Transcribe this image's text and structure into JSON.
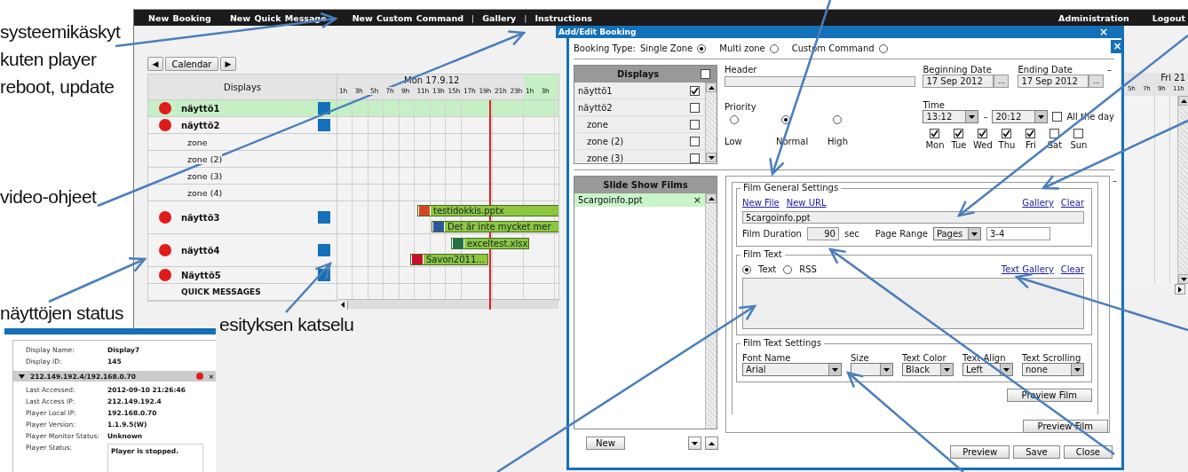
{
  "annotations": [
    {
      "lines": [
        "systeemikäskyt",
        "kuten player",
        "reboot, update"
      ]
    },
    {
      "lines": [
        "video-ohjeet"
      ]
    },
    {
      "lines": [
        "näyttöjen status"
      ]
    },
    {
      "lines": [
        "esityksen katselu"
      ]
    }
  ],
  "nav": {
    "left": [
      {
        "label": "New Booking",
        "kind": "link"
      },
      {
        "label": "New Quick Message",
        "kind": "link"
      },
      {
        "label": "New Custom Command",
        "kind": "link"
      },
      {
        "label": "|",
        "kind": "separator"
      },
      {
        "label": "Gallery",
        "kind": "link"
      },
      {
        "label": "|",
        "kind": "separator"
      },
      {
        "label": "Instructions",
        "kind": "link"
      }
    ],
    "right": [
      "Administration",
      "Logout"
    ]
  },
  "calendar": {
    "prev": "◀",
    "button": "Calendar",
    "next": "▶",
    "displays_header": "Displays",
    "day": "Mon 17.9.12",
    "hours": [
      "1h",
      "3h",
      "5h",
      "7h",
      "9h",
      "11h",
      "13h",
      "15h",
      "17h",
      "19h",
      "21h",
      "23h",
      "1h",
      "3h"
    ],
    "rows": [
      {
        "kind": "display",
        "name": "näyttö1",
        "color": "#e01b1b",
        "selected": true,
        "bookings": []
      },
      {
        "kind": "display",
        "name": "näyttö2",
        "color": "#e01b1b",
        "selected": false,
        "bookings": []
      },
      {
        "kind": "zone",
        "name": "zone"
      },
      {
        "kind": "zone",
        "name": "zone (2)"
      },
      {
        "kind": "zone",
        "name": "zone (3)"
      },
      {
        "kind": "zone",
        "name": "zone (4)"
      },
      {
        "kind": "display",
        "name": "näyttö3",
        "color": "#e01b1b",
        "selected": false,
        "bookings": [
          {
            "label": "testidokkis.pptx",
            "kind": "pptx"
          },
          {
            "label": "Det är inte mycket mer",
            "kind": "doc"
          }
        ]
      },
      {
        "kind": "display",
        "name": "näyttö4",
        "color": "#e01b1b",
        "selected": false,
        "bookings": [
          {
            "label": "exceltest.xlsx",
            "kind": "xlsx"
          },
          {
            "label": "Savon2011...",
            "kind": "pdf"
          }
        ]
      },
      {
        "kind": "display",
        "name": "Näyttö5",
        "color": "#e01b1b",
        "selected": false,
        "bookings": []
      },
      {
        "kind": "quick",
        "name": "QUICK MESSAGES"
      }
    ],
    "side_day": "Fri 21",
    "side_hours": [
      "5h",
      "7h",
      "9h",
      "11h"
    ]
  },
  "stats": {
    "fields": [
      {
        "label": "Display Name:",
        "value": "Display7"
      },
      {
        "label": "Display ID:",
        "value": "145"
      }
    ],
    "connection": {
      "address": "212.149.192.4/192.168.0.70",
      "expanded": true,
      "color": "#e01b1b",
      "close": "×"
    },
    "details": [
      {
        "label": "Last Accessed:",
        "value": "2012-09-10 21:26:46"
      },
      {
        "label": "Last Access IP:",
        "value": "212.149.192.4"
      },
      {
        "label": "Player Local IP:",
        "value": "192.168.0.70"
      },
      {
        "label": "Player Version:",
        "value": "1.1.9.5(W)"
      },
      {
        "label": "Player Monitor Status:",
        "value": "Unknown"
      }
    ],
    "status_label": "Player Status:",
    "status_value": "Player is stopped."
  },
  "dialog": {
    "title": "Add/Edit Booking",
    "close": "×",
    "close2": "×",
    "booking_type_label": "Booking Type:",
    "booking_types": [
      {
        "label": "Single Zone",
        "selected": true
      },
      {
        "label": "Multi zone",
        "selected": false
      },
      {
        "label": "Custom Command",
        "selected": false
      }
    ],
    "toggle": "–",
    "toggle2": "–",
    "displays": {
      "title": "Displays",
      "all_checked": false,
      "items": [
        {
          "name": "näyttö1",
          "checked": true,
          "zone": false
        },
        {
          "name": "näyttö2",
          "checked": false,
          "zone": false
        },
        {
          "name": "zone",
          "checked": false,
          "zone": true
        },
        {
          "name": "zone (2)",
          "checked": false,
          "zone": true
        },
        {
          "name": "zone (3)",
          "checked": false,
          "zone": true
        }
      ]
    },
    "header_label": "Header",
    "priority_label": "Priority",
    "priorities": [
      {
        "label": "Low",
        "selected": false
      },
      {
        "label": "Normal",
        "selected": true
      },
      {
        "label": "High",
        "selected": false
      }
    ],
    "begin_label": "Beginning Date",
    "begin": "17 Sep 2012",
    "end_label": "Ending Date",
    "end": "17 Sep 2012",
    "picker": "...",
    "time_label": "Time",
    "time_from": "13:12",
    "dash": "–",
    "time_to": "20:12",
    "all_day": {
      "label": "All the day",
      "checked": false
    },
    "days": [
      {
        "label": "Mon",
        "checked": true
      },
      {
        "label": "Tue",
        "checked": true
      },
      {
        "label": "Wed",
        "checked": true
      },
      {
        "label": "Thu",
        "checked": true
      },
      {
        "label": "Fri",
        "checked": true
      },
      {
        "label": "Sat",
        "checked": false
      },
      {
        "label": "Sun",
        "checked": false
      }
    ],
    "films": {
      "title": "Slide Show Films",
      "items": [
        {
          "name": "5cargoinfo.ppt",
          "selected": true,
          "remove": "×"
        }
      ]
    },
    "general": {
      "legend": "Film General Settings",
      "links_left": [
        "New File",
        "New URL"
      ],
      "links_right": [
        "Gallery",
        "Clear"
      ],
      "file": "5cargoinfo.ppt",
      "duration_label": "Film Duration",
      "duration": "90",
      "unit": "sec",
      "range_label": "Page Range",
      "range_mode": "Pages",
      "range": "3-4"
    },
    "text": {
      "legend": "Film Text",
      "options": [
        {
          "label": "Text",
          "selected": true
        },
        {
          "label": "RSS",
          "selected": false
        }
      ],
      "links": [
        "Text Gallery",
        "Clear"
      ]
    },
    "text_settings": {
      "legend": "Film Text Settings",
      "fields": [
        {
          "label": "Font Name",
          "value": "Arial"
        },
        {
          "label": "Size"
        },
        {
          "label": "Text Color",
          "value": "Black"
        },
        {
          "label": "Text Align",
          "value": "Left"
        },
        {
          "label": "Text Scrolling",
          "value": "none"
        }
      ]
    },
    "preview_film": [
      "Preview Film",
      "Preview Film"
    ],
    "new_button": "New",
    "footer_buttons": [
      "Preview",
      "Save",
      "Close"
    ]
  }
}
